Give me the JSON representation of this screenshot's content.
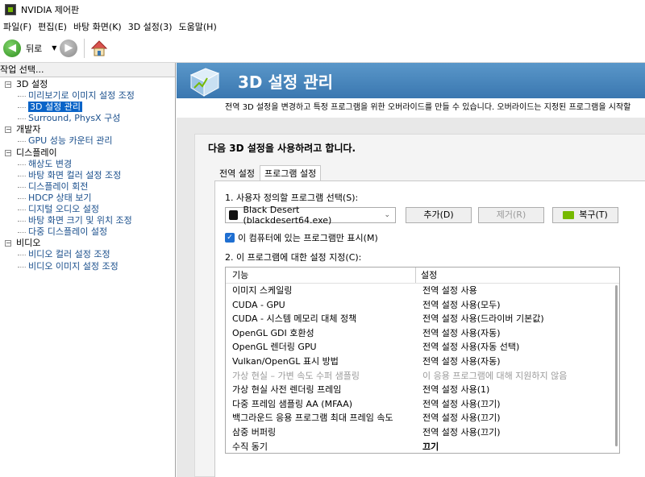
{
  "window": {
    "title": "NVIDIA 제어판"
  },
  "menu": [
    "파일(F)",
    "편집(E)",
    "바탕 화면(K)",
    "3D 설정(3)",
    "도움말(H)"
  ],
  "toolbar": {
    "back_label": "뒤로"
  },
  "left": {
    "task_header": "작업 선택...",
    "tree": [
      {
        "label": "3D 설정",
        "type": "cat"
      },
      {
        "label": "미리보기로 이미지 설정 조정",
        "type": "child"
      },
      {
        "label": "3D 설정 관리",
        "type": "child",
        "selected": true
      },
      {
        "label": "Surround, PhysX 구성",
        "type": "child"
      },
      {
        "label": "개발자",
        "type": "cat"
      },
      {
        "label": "GPU 성능 카운터 관리",
        "type": "child"
      },
      {
        "label": "디스플레이",
        "type": "cat"
      },
      {
        "label": "해상도 변경",
        "type": "child"
      },
      {
        "label": "바탕 화면 컬러 설정 조정",
        "type": "child"
      },
      {
        "label": "디스플레이 회전",
        "type": "child"
      },
      {
        "label": "HDCP 상태 보기",
        "type": "child"
      },
      {
        "label": "디지털 오디오 설정",
        "type": "child"
      },
      {
        "label": "바탕 화면 크기 및 위치 조정",
        "type": "child"
      },
      {
        "label": "다중 디스플레이 설정",
        "type": "child"
      },
      {
        "label": "비디오",
        "type": "cat"
      },
      {
        "label": "비디오 컬러 설정 조정",
        "type": "child"
      },
      {
        "label": "비디오 이미지 설정 조정",
        "type": "child"
      }
    ]
  },
  "main": {
    "title": "3D 설정 관리",
    "description": "전역 3D 설정을 변경하고 특정 프로그램을 위한 오버라이드를 만들 수 있습니다. 오버라이드는 지정된 프로그램을 시작할",
    "panel_heading": "다음 3D 설정을 사용하려고 합니다.",
    "tabs": [
      "전역 설정",
      "프로그램 설정"
    ],
    "active_tab": 1,
    "step1_label": "1. 사용자 정의할 프로그램 선택(S):",
    "program_selected": "Black Desert (blackdesert64.exe)",
    "add_button": "추가(D)",
    "remove_button": "제거(R)",
    "restore_button": "복구(T)",
    "checkbox_label": "이 컴퓨터에 있는 프로그램만 표시(M)",
    "checkbox_checked": true,
    "step2_label": "2. 이 프로그램에 대한 설정 지정(C):",
    "grid_headers": {
      "feature": "기능",
      "setting": "설정"
    },
    "grid_rows": [
      {
        "feature": "이미지 스케일링",
        "setting": "전역 설정 사용"
      },
      {
        "feature": "CUDA - GPU",
        "setting": "전역 설정 사용(모두)"
      },
      {
        "feature": "CUDA - 시스템 메모리 대체 정책",
        "setting": "전역 설정 사용(드라이버 기본값)"
      },
      {
        "feature": "OpenGL GDI 호환성",
        "setting": "전역 설정 사용(자동)"
      },
      {
        "feature": "OpenGL 렌더링 GPU",
        "setting": "전역 설정 사용(자동 선택)"
      },
      {
        "feature": "Vulkan/OpenGL 표시 방법",
        "setting": "전역 설정 사용(자동)"
      },
      {
        "feature": "가상 현실 – 가변 속도 수퍼 샘플링",
        "setting": "이 응용 프로그램에 대해 지원하지 않음",
        "disabled": true
      },
      {
        "feature": "가상 현실 사전 렌더링 프레임",
        "setting": "전역 설정 사용(1)"
      },
      {
        "feature": "다중 프레임 샘플링 AA (MFAA)",
        "setting": "전역 설정 사용(끄기)"
      },
      {
        "feature": "백그라운드 응용 프로그램 최대 프레임 속도",
        "setting": "전역 설정 사용(끄기)"
      },
      {
        "feature": "삼중 버퍼링",
        "setting": "전역 설정 사용(끄기)"
      },
      {
        "feature": "수직 동기",
        "setting": "끄기",
        "bold": true
      }
    ]
  },
  "colors": {
    "header_blue": "#3a77b0",
    "selection": "#0a64c8",
    "nvidia_green": "#76b900"
  }
}
